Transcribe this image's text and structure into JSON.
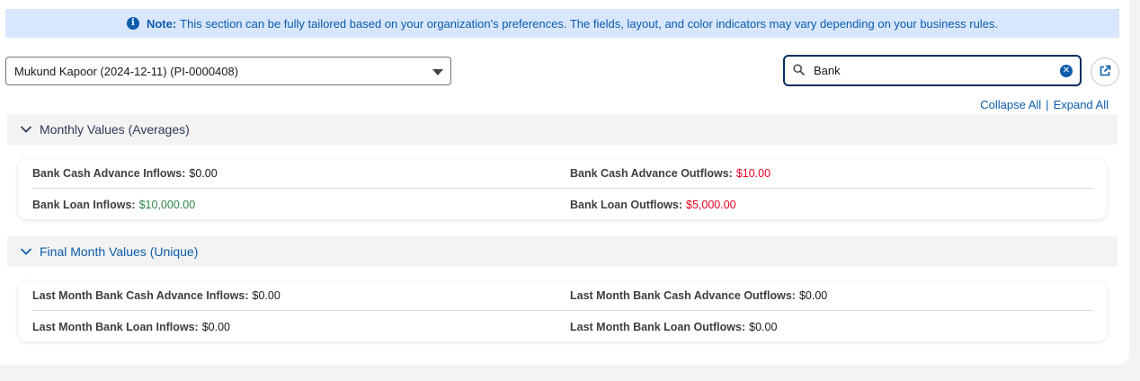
{
  "note": {
    "icon": "info-icon",
    "label": "Note:",
    "text": "This section can be fully tailored based on your organization's preferences. The fields, layout, and color indicators may vary depending on your business rules."
  },
  "record_select": {
    "value": "Mukund Kapoor (2024-12-11) (PI-0000408)"
  },
  "search": {
    "value": "Bank"
  },
  "links": {
    "collapse_all": "Collapse All",
    "separator": "|",
    "expand_all": "Expand All"
  },
  "sections": [
    {
      "title": "Monthly Values (Averages)",
      "rows": [
        [
          {
            "label": "Bank Cash Advance Inflows:",
            "value": "$0.00",
            "color": "default"
          },
          {
            "label": "Bank Cash Advance Outflows:",
            "value": "$10.00",
            "color": "red"
          }
        ],
        [
          {
            "label": "Bank Loan Inflows:",
            "value": "$10,000.00",
            "color": "green"
          },
          {
            "label": "Bank Loan Outflows:",
            "value": "$5,000.00",
            "color": "red"
          }
        ]
      ]
    },
    {
      "title": "Final Month Values (Unique)",
      "rows": [
        [
          {
            "label": "Last Month Bank Cash Advance Inflows:",
            "value": "$0.00",
            "color": "default"
          },
          {
            "label": "Last Month Bank Cash Advance Outflows:",
            "value": "$0.00",
            "color": "default"
          }
        ],
        [
          {
            "label": "Last Month Bank Loan Inflows:",
            "value": "$0.00",
            "color": "default"
          },
          {
            "label": "Last Month Bank Loan Outflows:",
            "value": "$0.00",
            "color": "default"
          }
        ]
      ]
    }
  ],
  "colors": {
    "accent": "#0b5cab",
    "red": "#ea001e",
    "green": "#2e844a"
  }
}
